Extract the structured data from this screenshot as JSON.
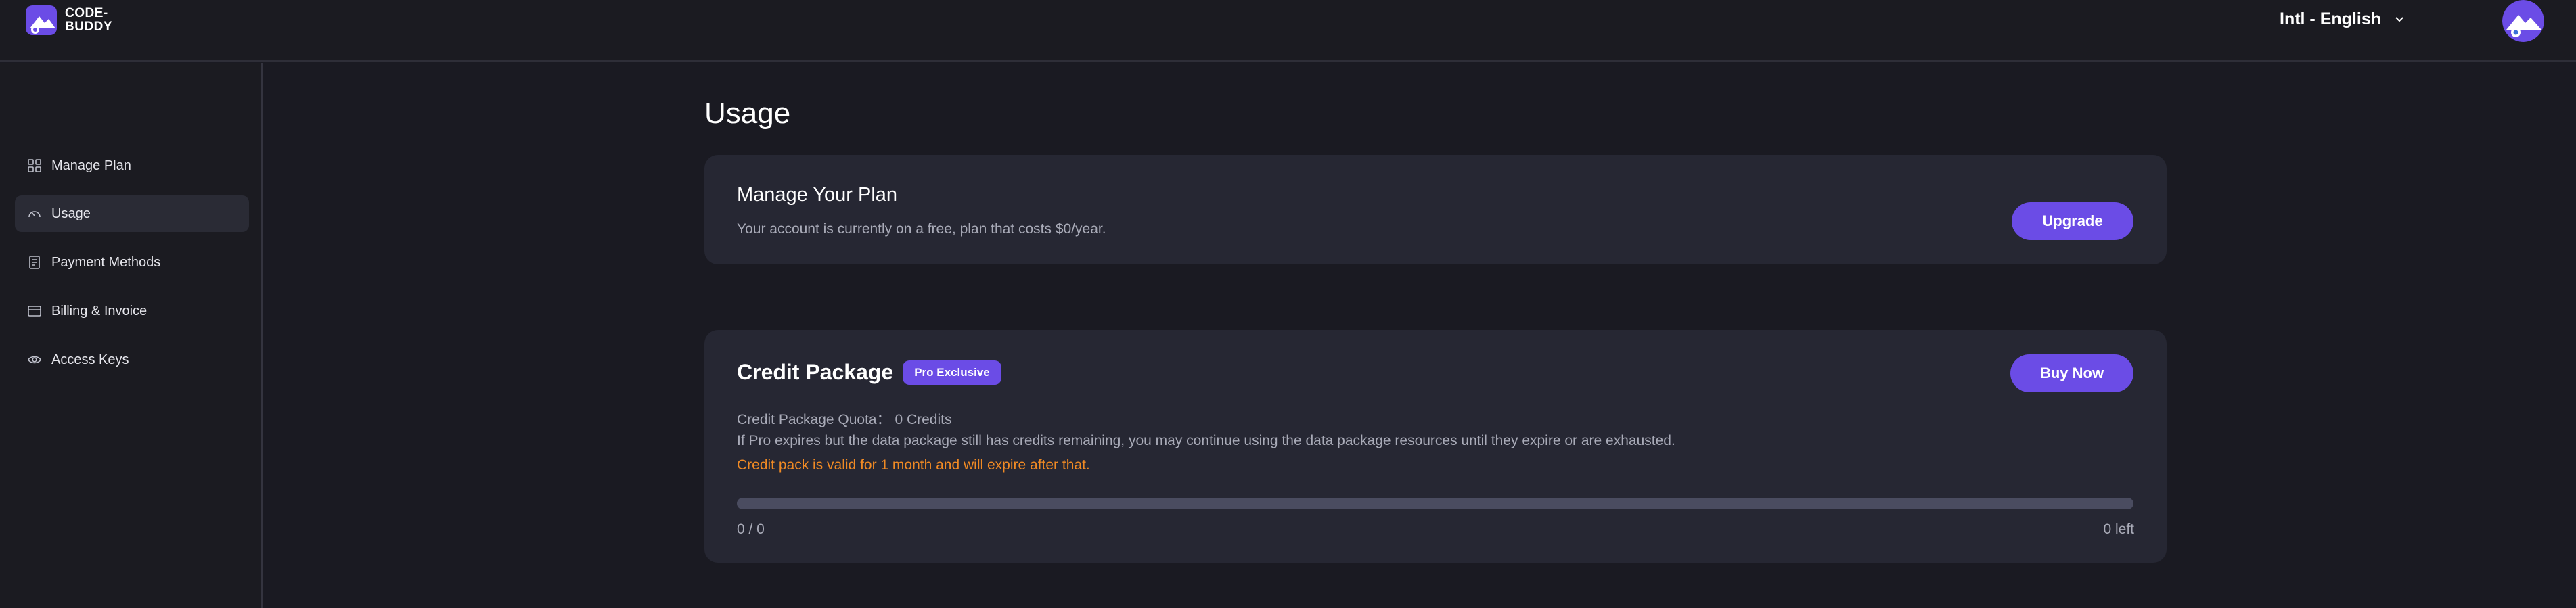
{
  "header": {
    "logo_text_line1": "CODE-",
    "logo_text_line2": "BUDDY",
    "language_label": "Intl - English"
  },
  "sidebar": {
    "items": [
      {
        "label": "Manage Plan",
        "icon": "grid-icon",
        "active": false
      },
      {
        "label": "Usage",
        "icon": "gauge-icon",
        "active": true
      },
      {
        "label": "Payment Methods",
        "icon": "receipt-icon",
        "active": false
      },
      {
        "label": "Billing & Invoice",
        "icon": "card-icon",
        "active": false
      },
      {
        "label": "Access Keys",
        "icon": "eye-icon",
        "active": false
      }
    ]
  },
  "main": {
    "title": "Usage",
    "plan_card": {
      "title": "Manage Your Plan",
      "description": "Your account is currently on a free, plan that costs $0/year.",
      "button_label": "Upgrade"
    },
    "credit_card": {
      "title": "Credit Package",
      "badge": "Pro Exclusive",
      "button_label": "Buy Now",
      "quota_text": "Credit Package Quota： 0 Credits",
      "note": "If Pro expires but the data package still has credits remaining, you may continue using the data package resources until they expire or are exhausted.",
      "warning": "Credit pack is valid for 1 month and will expire after that.",
      "progress_fraction": 0,
      "progress_label": "0 / 0",
      "remaining_label": "0 left"
    }
  },
  "colors": {
    "accent": "#6b4ce6",
    "warning": "#f08a24",
    "background": "#1a1a22",
    "card": "#262733"
  }
}
